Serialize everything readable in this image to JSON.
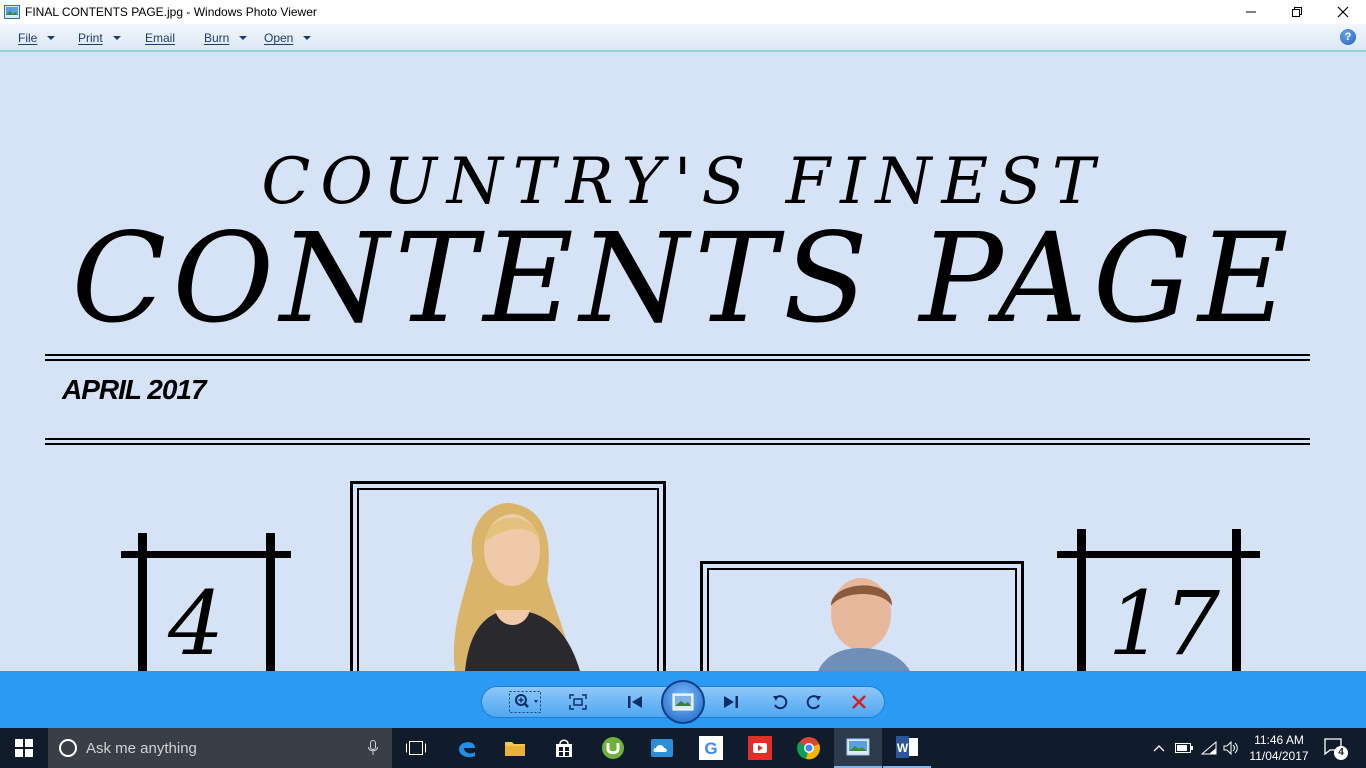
{
  "window": {
    "title": "FINAL CONTENTS PAGE.jpg - Windows Photo Viewer"
  },
  "menu": {
    "items": [
      {
        "label": "File",
        "dropdown": true
      },
      {
        "label": "Print",
        "dropdown": true
      },
      {
        "label": "Email",
        "dropdown": false
      },
      {
        "label": "Burn",
        "dropdown": true
      },
      {
        "label": "Open",
        "dropdown": true
      }
    ],
    "help_label": "?"
  },
  "image": {
    "subtitle": "COUNTRY'S FINEST",
    "title": "CONTENTS PAGE",
    "date": "APRIL 2017",
    "page_number_left": "4",
    "page_number_right": "17"
  },
  "taskbar": {
    "search_placeholder": "Ask me anything",
    "time": "11:46 AM",
    "date": "11/04/2017",
    "notification_count": "4"
  },
  "colors": {
    "viewer_bg": "#d6e2f5",
    "toolbar_bg": "#2b9af3",
    "taskbar_bg": "#101c2c"
  }
}
